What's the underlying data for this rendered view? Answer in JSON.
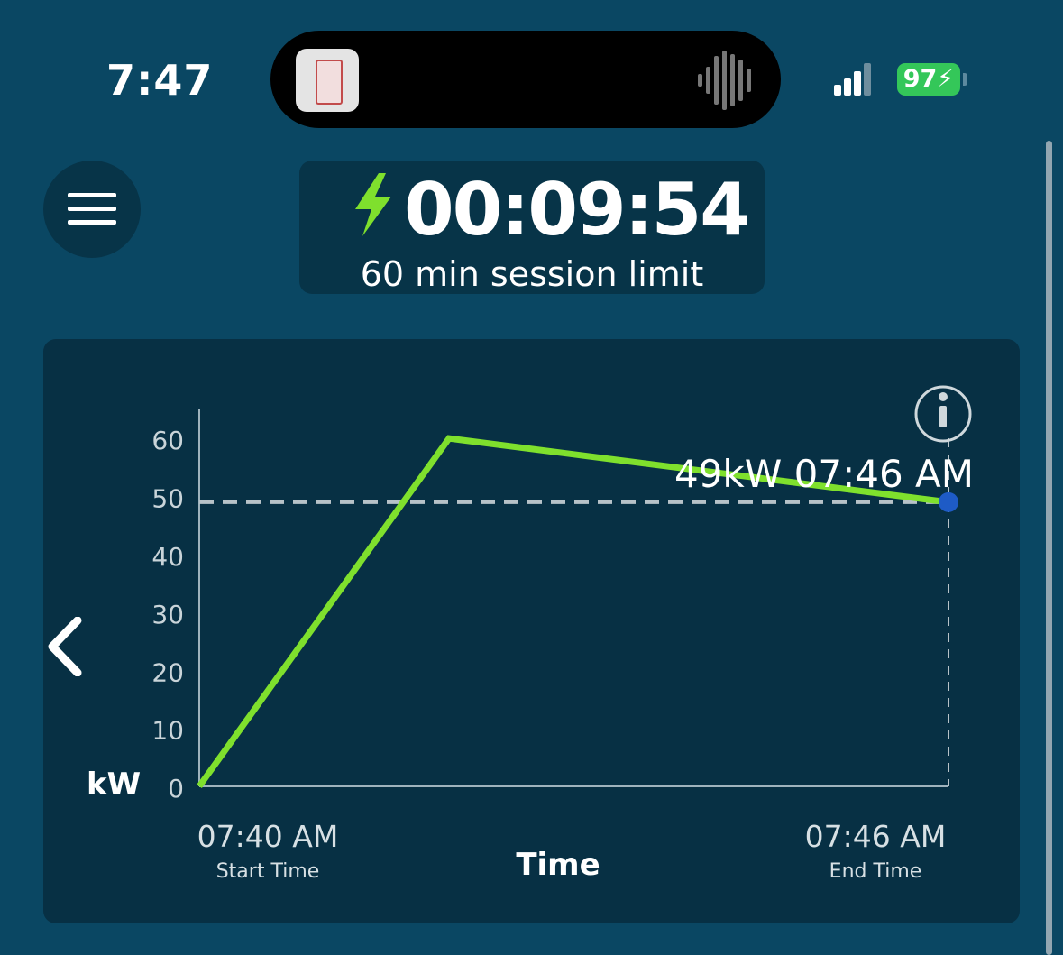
{
  "status_bar": {
    "time": "7:47",
    "battery": "97",
    "signal_bars": 4
  },
  "timer": {
    "elapsed": "00:09:54",
    "limit_text": "60 min session limit"
  },
  "chart_data": {
    "type": "line",
    "title": "",
    "ylabel": "kW",
    "xlabel": "Time",
    "ylim": [
      0,
      65
    ],
    "y_ticks": [
      0,
      10,
      20,
      30,
      40,
      50,
      60
    ],
    "y_tick_labels": [
      "0",
      "10",
      "20",
      "30",
      "40",
      "50",
      "60"
    ],
    "x_start_label": "07:40 AM",
    "x_start_caption": "Start Time",
    "x_end_label": "07:46 AM",
    "x_end_caption": "End Time",
    "series": [
      {
        "color": "#7fe02d",
        "points": [
          {
            "t": 0,
            "kw": 0
          },
          {
            "t": 2.0,
            "kw": 60
          },
          {
            "t": 6.0,
            "kw": 49
          }
        ]
      }
    ],
    "x_range_minutes": [
      0,
      6
    ],
    "marker": {
      "t": 6.0,
      "kw": 49,
      "label": "49kW 07:46 AM",
      "color": "#1e5bc6"
    }
  },
  "colors": {
    "background": "#0a4763",
    "card": "#073044",
    "line": "#7fe02d",
    "bolt": "#7fe02d",
    "battery": "#34c759"
  }
}
